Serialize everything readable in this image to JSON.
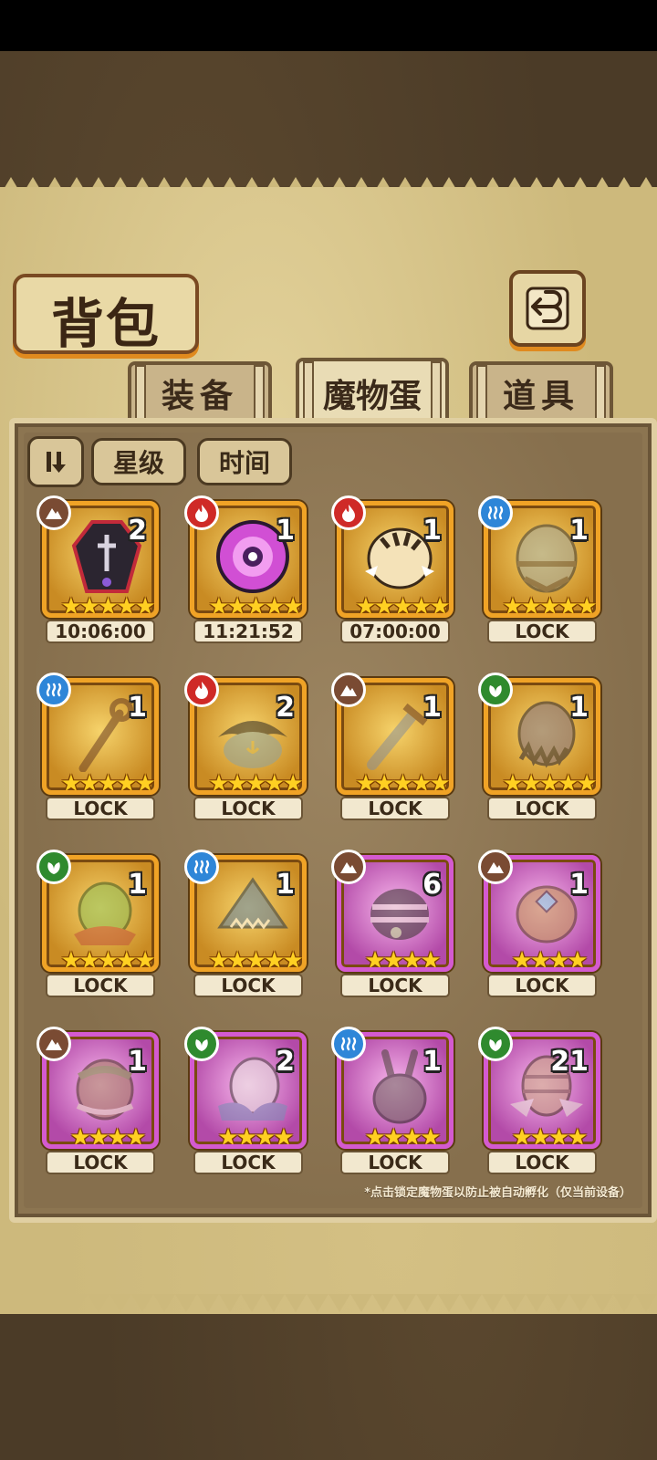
{
  "title": "背包",
  "tabs": [
    {
      "label": "装备",
      "active": false
    },
    {
      "label": "魔物蛋",
      "active": true
    },
    {
      "label": "道具",
      "active": false
    }
  ],
  "filters": {
    "star": "星级",
    "time": "时间"
  },
  "cards": [
    {
      "element": "earth",
      "count": "2",
      "stars": "★★★★★",
      "label": "10:06:00",
      "frame": "gold",
      "icon": "coffin-egg-icon"
    },
    {
      "element": "fire",
      "count": "1",
      "stars": "★★★★★",
      "label": "11:21:52",
      "frame": "gold",
      "icon": "eye-orb-egg-icon"
    },
    {
      "element": "fire",
      "count": "1",
      "stars": "★★★★★",
      "label": "07:00:00",
      "frame": "gold",
      "icon": "tiger-egg-icon"
    },
    {
      "element": "water",
      "count": "1",
      "stars": "★★★★★",
      "label": "LOCK",
      "frame": "gold",
      "icon": "armored-egg-icon"
    },
    {
      "element": "water",
      "count": "1",
      "stars": "★★★★★",
      "label": "LOCK",
      "frame": "gold",
      "icon": "staff-egg-icon"
    },
    {
      "element": "fire",
      "count": "2",
      "stars": "★★★★★",
      "label": "LOCK",
      "frame": "gold",
      "icon": "pirate-hat-egg-icon"
    },
    {
      "element": "earth",
      "count": "1",
      "stars": "★★★★★",
      "label": "LOCK",
      "frame": "gold",
      "icon": "sword-egg-icon"
    },
    {
      "element": "wood",
      "count": "1",
      "stars": "★★★★★",
      "label": "LOCK",
      "frame": "gold",
      "icon": "thorn-egg-icon"
    },
    {
      "element": "wood",
      "count": "1",
      "stars": "★★★★★",
      "label": "LOCK",
      "frame": "gold",
      "icon": "leaf-egg-icon"
    },
    {
      "element": "water",
      "count": "1",
      "stars": "★★★★★",
      "label": "LOCK",
      "frame": "gold",
      "icon": "shark-egg-icon"
    },
    {
      "element": "earth",
      "count": "6",
      "stars": "★★★★",
      "label": "LOCK",
      "frame": "purple",
      "icon": "striped-bug-egg-icon"
    },
    {
      "element": "earth",
      "count": "1",
      "stars": "★★★★",
      "label": "LOCK",
      "frame": "purple",
      "icon": "furry-gem-egg-icon"
    },
    {
      "element": "earth",
      "count": "1",
      "stars": "★★★★",
      "label": "LOCK",
      "frame": "purple",
      "icon": "nest-egg-icon"
    },
    {
      "element": "wood",
      "count": "2",
      "stars": "★★★★",
      "label": "LOCK",
      "frame": "purple",
      "icon": "feather-egg-icon"
    },
    {
      "element": "water",
      "count": "1",
      "stars": "★★★★",
      "label": "LOCK",
      "frame": "purple",
      "icon": "rabbit-egg-icon"
    },
    {
      "element": "wood",
      "count": "21",
      "stars": "★★★★",
      "label": "LOCK",
      "frame": "purple",
      "icon": "winged-egg-icon"
    }
  ],
  "hint": "*点击锁定魔物蛋以防止被自动孵化（仅当前设备）"
}
